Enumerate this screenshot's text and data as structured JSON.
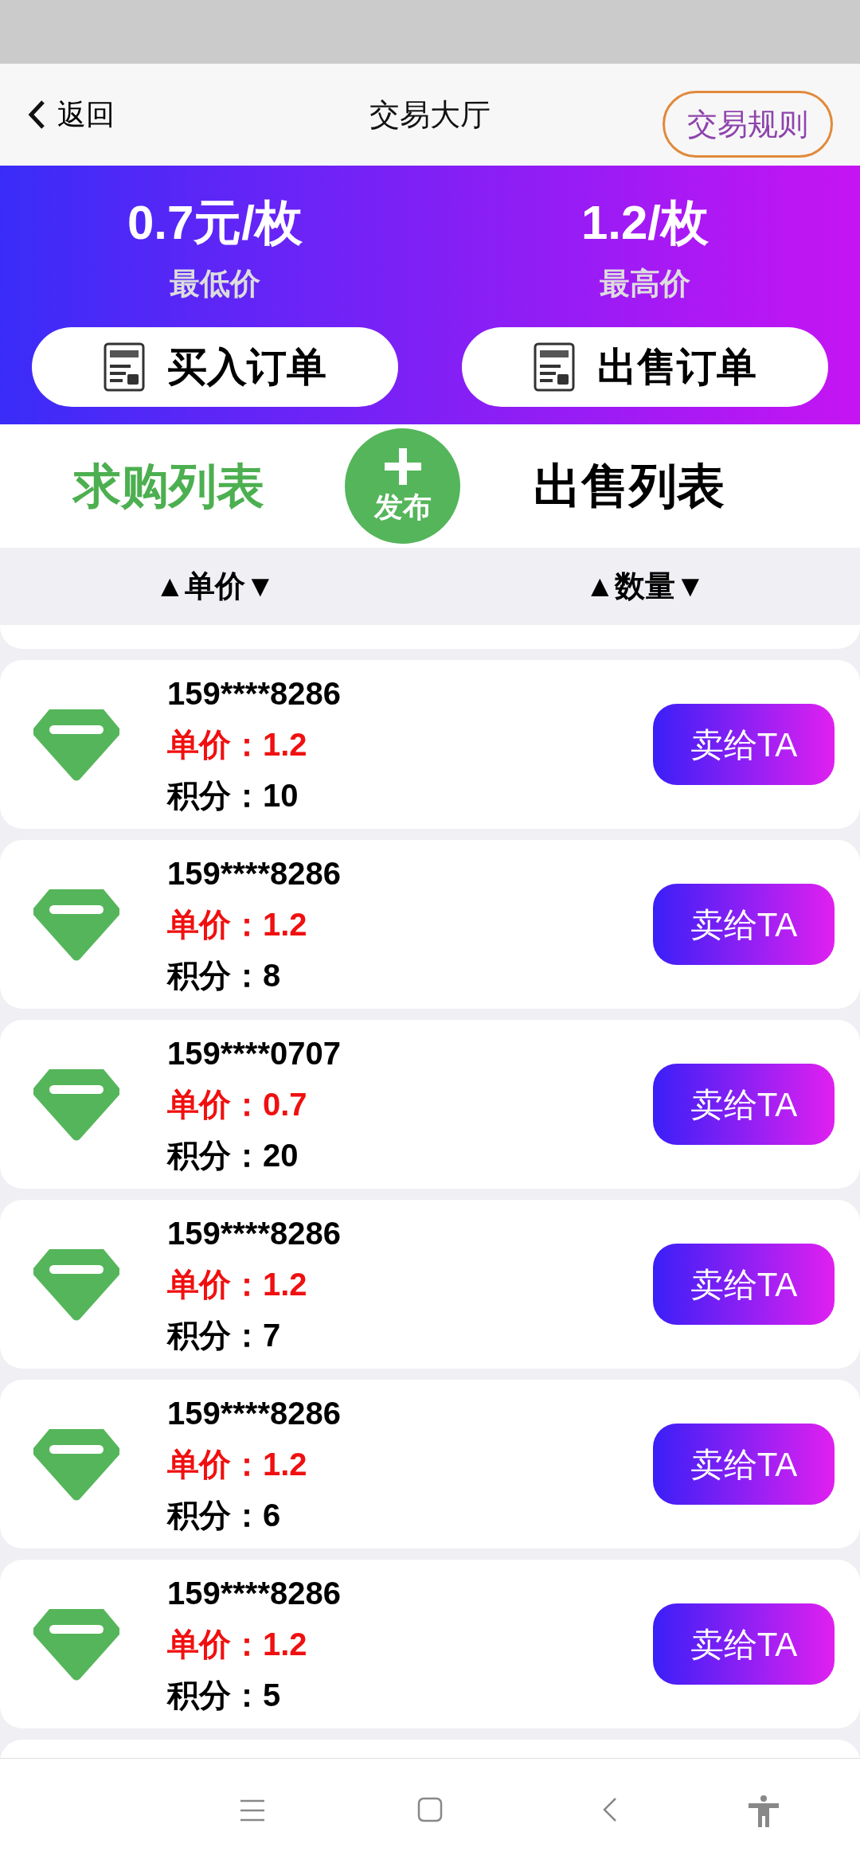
{
  "header": {
    "back_label": "返回",
    "title": "交易大厅",
    "rules_button": "交易规则"
  },
  "banner": {
    "stats": [
      {
        "value": "0.7元/枚",
        "label": "最低价"
      },
      {
        "value": "1.2/枚",
        "label": "最高价"
      }
    ],
    "order_buttons": [
      "买入订单",
      "出售订单"
    ]
  },
  "tabs": [
    {
      "label": "求购列表",
      "selected": true
    },
    {
      "label": "出售列表",
      "selected": false
    }
  ],
  "publish_button": {
    "label": "发布"
  },
  "sort": [
    "▲单价▼",
    "▲数量▼"
  ],
  "rows": [
    {
      "phone": "159****8286",
      "price": "单价：1.2",
      "points": "积分：10",
      "button": "卖给TA"
    },
    {
      "phone": "159****8286",
      "price": "单价：1.2",
      "points": "积分：8",
      "button": "卖给TA"
    },
    {
      "phone": "159****0707",
      "price": "单价：0.7",
      "points": "积分：20",
      "button": "卖给TA"
    },
    {
      "phone": "159****8286",
      "price": "单价：1.2",
      "points": "积分：7",
      "button": "卖给TA"
    },
    {
      "phone": "159****8286",
      "price": "单价：1.2",
      "points": "积分：6",
      "button": "卖给TA"
    },
    {
      "phone": "159****8286",
      "price": "单价：1.2",
      "points": "积分：5",
      "button": "卖给TA"
    }
  ]
}
